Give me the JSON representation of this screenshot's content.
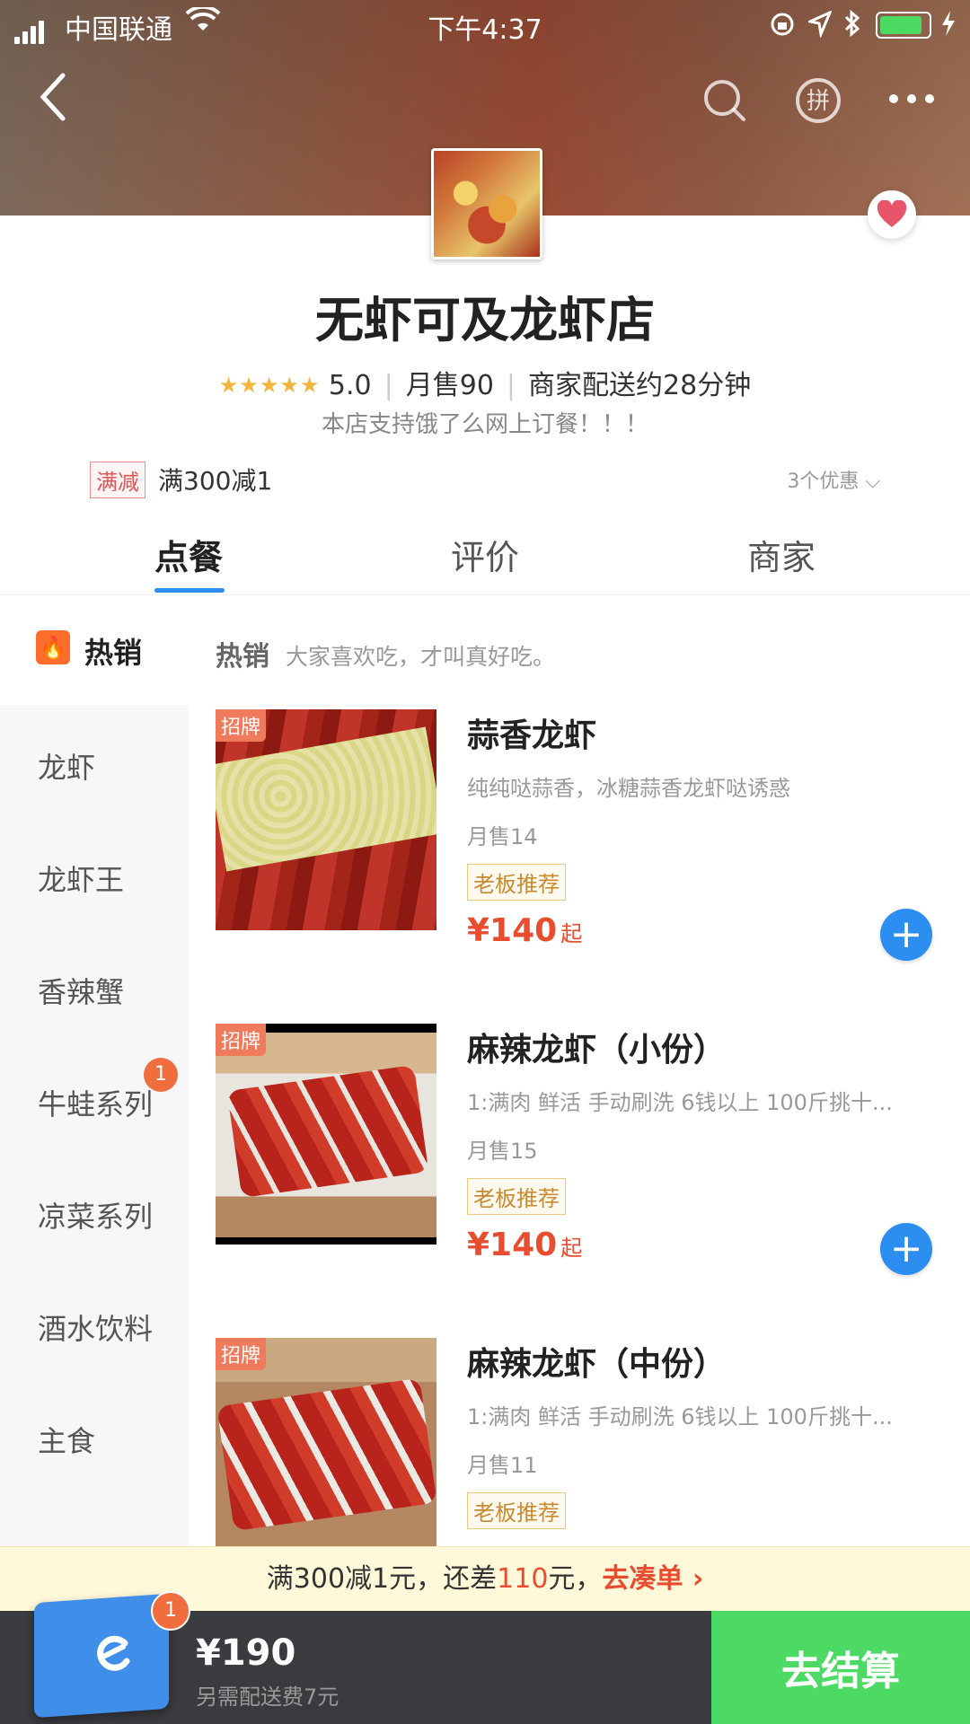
{
  "status_bar": {
    "carrier": "中国联通",
    "time": "下午4:37",
    "battery_level": 0.95
  },
  "nav": {
    "back_icon": "chevron-left-icon",
    "search_icon": "search-icon",
    "group_icon": "pin-icon",
    "more_icon": "more-icon"
  },
  "shop": {
    "name": "无虾可及龙虾店",
    "stars": "★★★★★",
    "rating": "5.0",
    "monthly_sales": "月售90",
    "delivery": "商家配送约28分钟",
    "notice": "本店支持饿了么网上订餐！！！",
    "promo_tag": "满减",
    "promo_text": "满300减1",
    "promo_more": "3个优惠 ⌵"
  },
  "tabs": [
    {
      "label": "点餐",
      "active": true
    },
    {
      "label": "评价",
      "active": false
    },
    {
      "label": "商家",
      "active": false
    }
  ],
  "hot": {
    "sidebar_label": "热销",
    "section_title": "热销",
    "section_desc": "大家喜欢吃，才叫真好吃。"
  },
  "categories": [
    "龙虾",
    "龙虾王",
    "香辣蟹",
    "牛蛙系列",
    "凉菜系列",
    "酒水饮料",
    "主食"
  ],
  "category_badge": "1",
  "products": [
    {
      "tag": "招牌",
      "name": "蒜香龙虾",
      "desc": "纯纯哒蒜香，冰糖蒜香龙虾哒诱惑",
      "sold": "月售14",
      "recommend": "老板推荐",
      "price": "¥140",
      "from": "起"
    },
    {
      "tag": "招牌",
      "name": "麻辣龙虾（小份）",
      "desc": "1:满肉 鲜活  手动刷洗 6钱以上 100斤挑十...",
      "sold": "月售15",
      "recommend": "老板推荐",
      "price": "¥140",
      "from": "起"
    },
    {
      "tag": "招牌",
      "name": "麻辣龙虾（中份）",
      "desc": "1:满肉 鲜活  手动刷洗 6钱以上 100斤挑十...",
      "sold": "月售11",
      "recommend": "老板推荐",
      "price": "",
      "from": ""
    }
  ],
  "tip_bar": {
    "prefix": "满300减1元，还差",
    "amount": "110",
    "suffix": "元，",
    "link": "去凑单 ›"
  },
  "cart": {
    "count": "1",
    "total": "¥190",
    "fee": "另需配送费7元",
    "checkout": "去结算"
  },
  "colors": {
    "accent": "#2b8ef0",
    "price": "#e84d2f",
    "checkout": "#4cd964",
    "cart_bar": "#3a3b3f"
  }
}
